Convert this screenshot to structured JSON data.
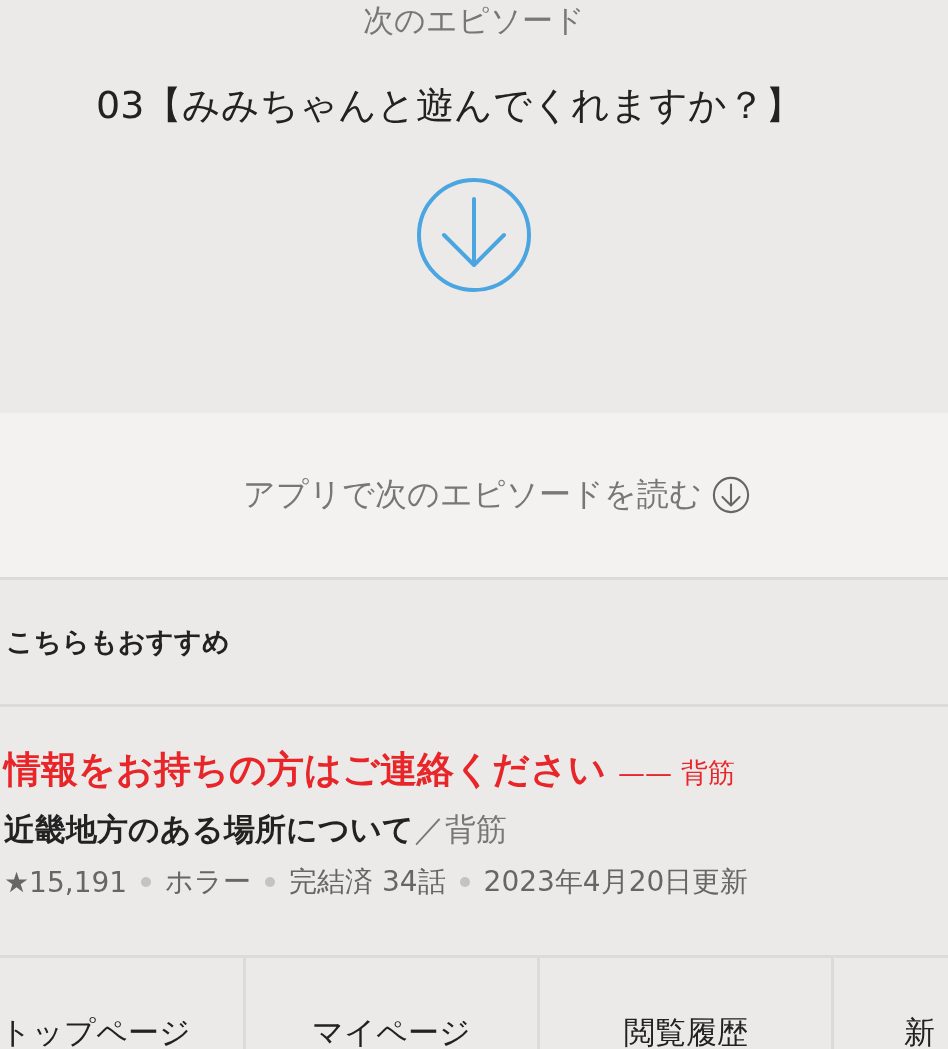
{
  "next_episode": {
    "label": "次のエピソード",
    "title": "03【みみちゃんと遊んでくれますか？】"
  },
  "app_link": {
    "label": "アプリで次のエピソードを読む"
  },
  "recommend": {
    "heading": "こちらもおすすめ",
    "items": [
      {
        "catch": "情報をお持ちの方はご連絡ください",
        "catch_author": "—— 背筋",
        "title": "近畿地方のある場所について",
        "author": "／背筋",
        "meta": [
          "★15,191",
          "ホラー",
          "完結済 34話",
          "2023年4月20日更新"
        ]
      }
    ]
  },
  "bottom_nav": [
    {
      "label": "トップページ"
    },
    {
      "label": "マイページ"
    },
    {
      "label": "閲覧履歴"
    },
    {
      "label": "新"
    }
  ]
}
